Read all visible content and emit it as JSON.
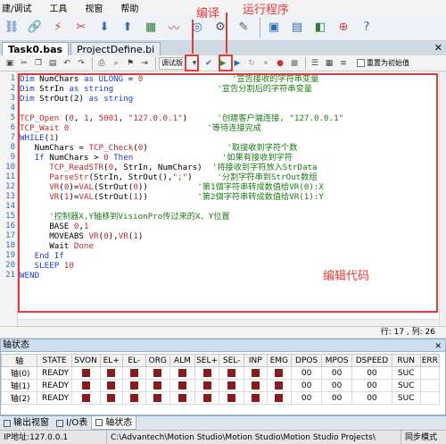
{
  "menu": [
    "建/调试",
    "工具",
    "视窗",
    "帮助"
  ],
  "annotations": {
    "compile": "编译",
    "run": "运行程序",
    "edit": "编辑代码"
  },
  "doc_tabs": [
    "Task0.bas",
    "ProjectDefine.bi"
  ],
  "editor_toolbar": {
    "mode_select": "调试版",
    "reset_label": "重置为初始值"
  },
  "code_lines": [
    {
      "n": "1",
      "segs": [
        [
          "kw",
          "Dim "
        ],
        [
          "id",
          "NumChars "
        ],
        [
          "kw",
          "as "
        ],
        [
          "kw",
          "ULONG "
        ],
        [
          "id",
          "= "
        ],
        [
          "num",
          "0"
        ],
        [
          "cm",
          "                  '宣告接收的字符串变量"
        ]
      ]
    },
    {
      "n": "2",
      "segs": [
        [
          "kw",
          "Dim "
        ],
        [
          "id",
          "StrIn "
        ],
        [
          "kw",
          "as "
        ],
        [
          "kw",
          "string"
        ],
        [
          "cm",
          "                     '宣告分割后的字符串变量"
        ]
      ]
    },
    {
      "n": "3",
      "segs": [
        [
          "kw",
          "Dim "
        ],
        [
          "id",
          "StrOut(2) "
        ],
        [
          "kw",
          "as "
        ],
        [
          "kw",
          "string"
        ]
      ]
    },
    {
      "n": "4",
      "segs": []
    },
    {
      "n": "5",
      "segs": [
        [
          "fn",
          "TCP_Open "
        ],
        [
          "id",
          "("
        ],
        [
          "num",
          "0"
        ],
        [
          "id",
          ", "
        ],
        [
          "num",
          "1"
        ],
        [
          "id",
          ", "
        ],
        [
          "num",
          "5001"
        ],
        [
          "id",
          ", "
        ],
        [
          "str",
          "\"127.0.0.1\""
        ],
        [
          "id",
          ")"
        ],
        [
          "cm",
          "      '创建客户端连接, \"127.0.0.1\""
        ]
      ]
    },
    {
      "n": "6",
      "segs": [
        [
          "fn",
          "TCP_Wait "
        ],
        [
          "num",
          "0"
        ],
        [
          "cm",
          "                            '等待连接完成"
        ]
      ]
    },
    {
      "n": "7",
      "segs": [
        [
          "kw",
          "WHILE"
        ],
        [
          "id",
          "("
        ],
        [
          "num",
          "1"
        ],
        [
          "id",
          ")"
        ]
      ]
    },
    {
      "n": "8",
      "segs": [
        [
          "id",
          "   NumChars = "
        ],
        [
          "fn",
          "TCP_Check"
        ],
        [
          "id",
          "("
        ],
        [
          "num",
          "0"
        ],
        [
          "id",
          ")"
        ],
        [
          "cm",
          "                '取接收到字符个数"
        ]
      ]
    },
    {
      "n": "9",
      "segs": [
        [
          "kw",
          "   If "
        ],
        [
          "id",
          "NumChars > "
        ],
        [
          "num",
          "0 "
        ],
        [
          "kw",
          "Then"
        ],
        [
          "cm",
          "                  '如果有接收到字符"
        ]
      ]
    },
    {
      "n": "10",
      "segs": [
        [
          "fn",
          "      TCP_ReadSTR"
        ],
        [
          "id",
          "("
        ],
        [
          "num",
          "0"
        ],
        [
          "id",
          ", StrIn, NumChars)"
        ],
        [
          "cm",
          "  '将接收到字符放入StrData"
        ]
      ]
    },
    {
      "n": "11",
      "segs": [
        [
          "fn",
          "      ParseStr"
        ],
        [
          "id",
          "(StrIn, StrOut(),"
        ],
        [
          "str",
          "\";\""
        ],
        [
          "id",
          ")"
        ],
        [
          "cm",
          "     '分割字符串到StrOut数组"
        ]
      ]
    },
    {
      "n": "12",
      "segs": [
        [
          "fn",
          "      VR"
        ],
        [
          "id",
          "("
        ],
        [
          "num",
          "0"
        ],
        [
          "id",
          ")="
        ],
        [
          "fn",
          "VAL"
        ],
        [
          "id",
          "(StrOut("
        ],
        [
          "num",
          "0"
        ],
        [
          "id",
          "))"
        ],
        [
          "cm",
          "          '第1個字符串转成数值给VR(0):X"
        ]
      ]
    },
    {
      "n": "13",
      "segs": [
        [
          "fn",
          "      VR"
        ],
        [
          "id",
          "("
        ],
        [
          "num",
          "1"
        ],
        [
          "id",
          ")="
        ],
        [
          "fn",
          "VAL"
        ],
        [
          "id",
          "(StrOut("
        ],
        [
          "num",
          "1"
        ],
        [
          "id",
          "))"
        ],
        [
          "cm",
          "          '第2個字符串转成数值给VR(1):Y"
        ]
      ]
    },
    {
      "n": "14",
      "segs": []
    },
    {
      "n": "15",
      "segs": [
        [
          "cm",
          "      '控制器X,Y轴移到VisionPro传过来的X、Y位置"
        ]
      ]
    },
    {
      "n": "16",
      "segs": [
        [
          "id",
          "      BASE "
        ],
        [
          "num",
          "0"
        ],
        [
          "id",
          ","
        ],
        [
          "num",
          "1"
        ]
      ]
    },
    {
      "n": "17",
      "segs": [
        [
          "id",
          "      MOVEABS "
        ],
        [
          "fn",
          "VR"
        ],
        [
          "id",
          "("
        ],
        [
          "num",
          "0"
        ],
        [
          "id",
          "),"
        ],
        [
          "fn",
          "VR"
        ],
        [
          "id",
          "("
        ],
        [
          "num",
          "1"
        ],
        [
          "id",
          ")"
        ]
      ]
    },
    {
      "n": "18",
      "segs": [
        [
          "id",
          "      Wait "
        ],
        [
          "fn",
          "Done"
        ]
      ]
    },
    {
      "n": "19",
      "segs": [
        [
          "kw",
          "   End If"
        ]
      ]
    },
    {
      "n": "20",
      "segs": [
        [
          "kw",
          "   SLEEP "
        ],
        [
          "num",
          "10"
        ]
      ]
    },
    {
      "n": "21",
      "segs": [
        [
          "kw",
          "WEND"
        ]
      ]
    }
  ],
  "cursor_pos": "行: 17 , 列: 26",
  "axis_panel": {
    "title": "轴状态",
    "columns": [
      "轴",
      "STATE",
      "SVON",
      "EL+",
      "EL-",
      "ORG",
      "ALM",
      "SEL+",
      "SEL-",
      "INP",
      "EMG",
      "DPOS",
      "MPOS",
      "DSPEED",
      "RUN",
      "ERR"
    ],
    "rows": [
      {
        "axis": "轴(0)",
        "state": "READY",
        "dpos": "00",
        "mpos": "00",
        "dspeed": "00",
        "run": "SUC"
      },
      {
        "axis": "轴(1)",
        "state": "READY",
        "dpos": "00",
        "mpos": "00",
        "dspeed": "00",
        "run": "SUC"
      },
      {
        "axis": "轴(2)",
        "state": "READY",
        "dpos": "00",
        "mpos": "00",
        "dspeed": "00",
        "run": "SUC"
      }
    ]
  },
  "bottom_tabs": [
    "输出视窗",
    "I/O表",
    "轴状态"
  ],
  "status_bar": {
    "ip": "IP地址:127.0.0.1",
    "path": "C:\\Advantech\\Motion Studio\\Motion Studio\\Motion Studio Projects\\",
    "mode": "同步模式"
  }
}
